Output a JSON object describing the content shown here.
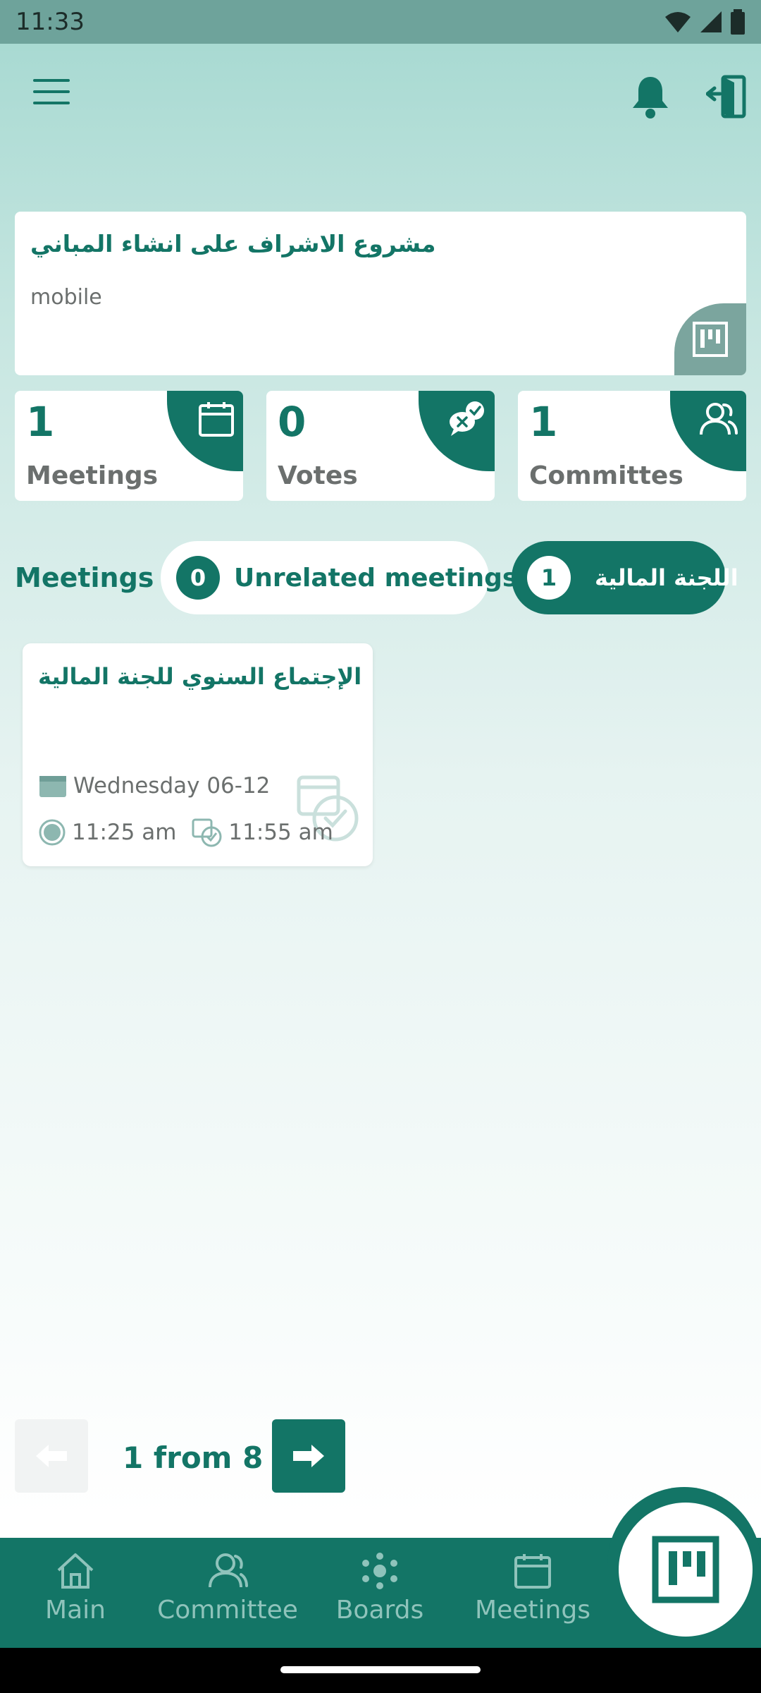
{
  "status_bar": {
    "time": "11:33"
  },
  "project": {
    "title": "مشروع الاشراف على انشاء المباني",
    "subtitle": "mobile"
  },
  "stats": [
    {
      "value": "1",
      "label": "Meetings",
      "icon": "calendar-icon"
    },
    {
      "value": "0",
      "label": "Votes",
      "icon": "vote-icon"
    },
    {
      "value": "1",
      "label": "Committes",
      "icon": "users-icon"
    }
  ],
  "filters": {
    "label": "Meetings",
    "chips": [
      {
        "count": "0",
        "label": "Unrelated meetings",
        "selected": false
      },
      {
        "count": "1",
        "label": "اللجنة المالية",
        "selected": true
      }
    ]
  },
  "meetings": [
    {
      "title": "الإجتماع السنوي للجنة المالية",
      "date": "Wednesday 06-12",
      "start": "11:25 am",
      "end": "11:55 am"
    }
  ],
  "pager": {
    "text": "1 from 8"
  },
  "bottom_nav": [
    {
      "label": "Main",
      "icon": "home-icon"
    },
    {
      "label": "Committee",
      "icon": "committee-icon"
    },
    {
      "label": "Boards",
      "icon": "boards-icon"
    },
    {
      "label": "Meetings",
      "icon": "calendar-icon"
    }
  ],
  "colors": {
    "primary": "#137566",
    "muted": "#6b6f6e",
    "nav_inactive": "#8fc3bb"
  }
}
